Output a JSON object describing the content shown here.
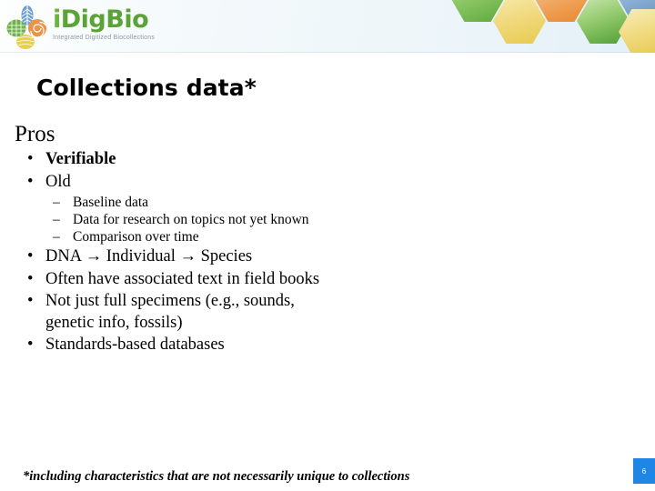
{
  "header": {
    "logo": {
      "wordmark_i": "i",
      "wordmark_dig": "Dig",
      "wordmark_bio": "Bio",
      "tagline": "Integrated Digitized Biocollections",
      "brand_green": "#6cb33f"
    },
    "hexagons": [
      {
        "name": "hex-green-1",
        "color": "#8cc765"
      },
      {
        "name": "hex-yellow-1",
        "color": "#f0d97d"
      },
      {
        "name": "hex-orange-1",
        "color": "#f0a964"
      },
      {
        "name": "hex-green-2",
        "color": "#93ca6d"
      },
      {
        "name": "hex-blue-1",
        "color": "#8aaed4"
      },
      {
        "name": "hex-yellow-2",
        "color": "#f1dc86"
      }
    ]
  },
  "slide": {
    "title": "Collections data*",
    "heading": "Pros",
    "bullets": [
      {
        "text": "Verifiable",
        "bold": true,
        "marker": "•"
      },
      {
        "text": "Old",
        "bold": false,
        "marker": "•"
      },
      {
        "text": "DNA → Individual → Species",
        "bold": false,
        "marker": "•"
      },
      {
        "text": "Often have associated text in field books",
        "bold": false,
        "marker": "•"
      },
      {
        "text": "Not just full specimens (e.g., sounds, genetic info, fossils)",
        "bold": false,
        "marker": "•"
      },
      {
        "text": "Standards-based databases",
        "bold": false,
        "marker": "•"
      }
    ],
    "subbullets": [
      {
        "text": "Baseline data",
        "marker": "–"
      },
      {
        "text": "Data for research on topics not yet known",
        "marker": "–"
      },
      {
        "text": "Comparison over time",
        "marker": "–"
      }
    ],
    "footnote": "*including characteristics that are not necessarily unique to collections",
    "page_number": "6",
    "page_badge_color": "#1f86e6"
  }
}
